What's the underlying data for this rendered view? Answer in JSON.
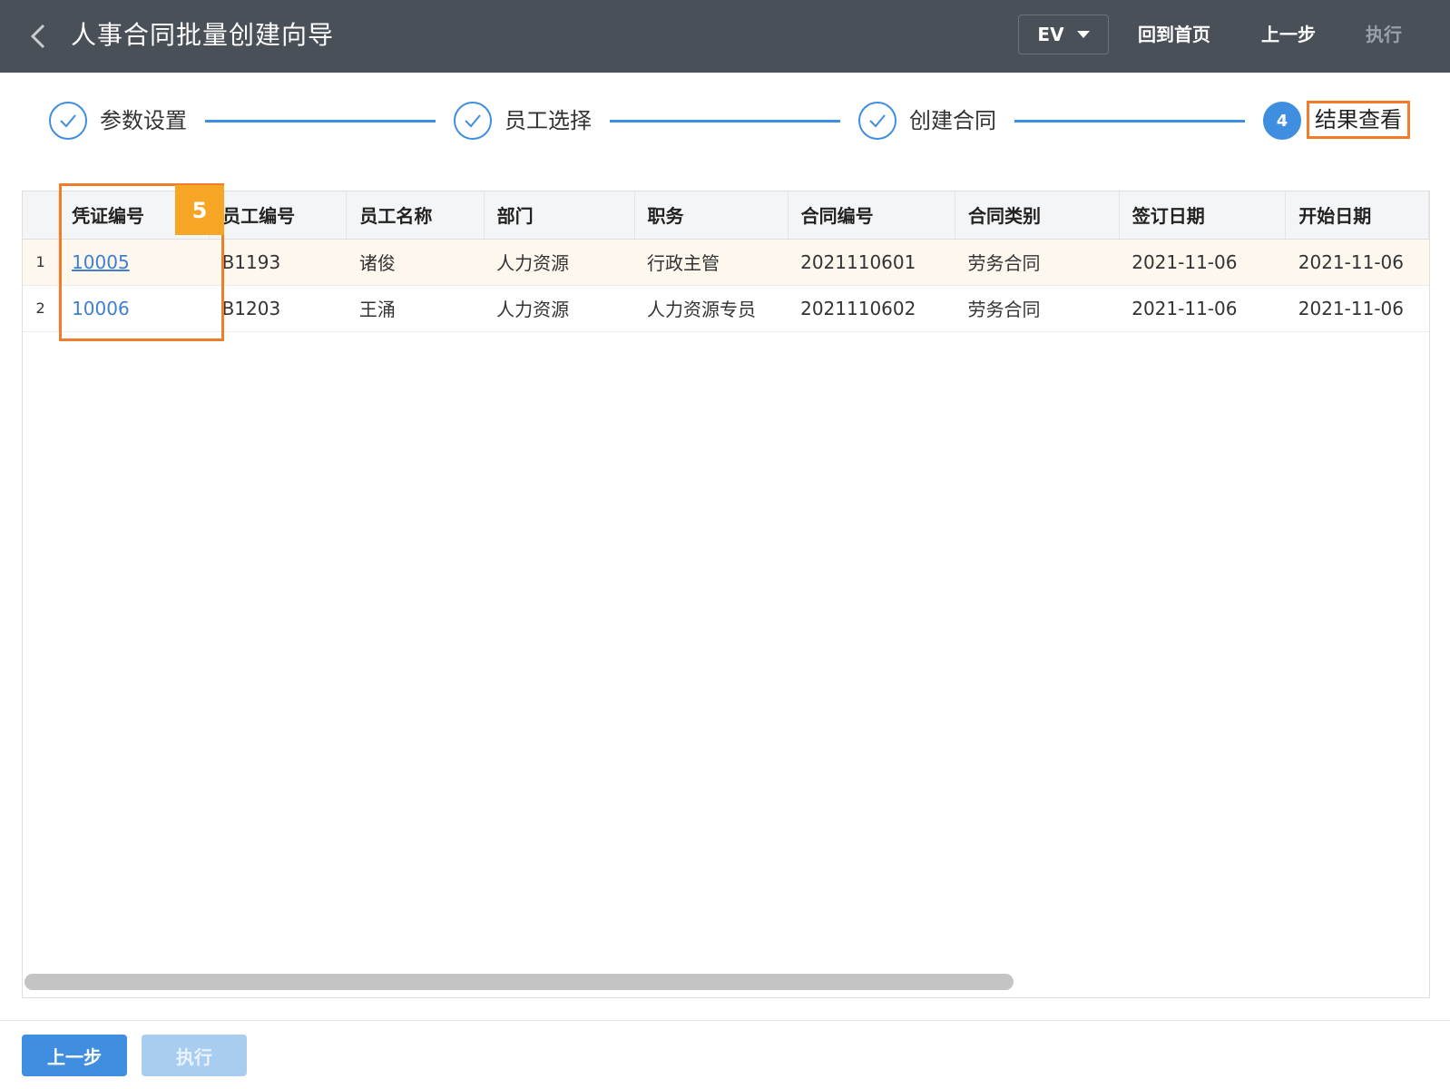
{
  "header": {
    "title": "人事合同批量创建向导",
    "language": "EV",
    "home_label": "回到首页",
    "prev_label": "上一步",
    "execute_label": "执行"
  },
  "steps": [
    {
      "label": "参数设置",
      "status": "done"
    },
    {
      "label": "员工选择",
      "status": "done"
    },
    {
      "label": "创建合同",
      "status": "done"
    },
    {
      "label": "结果查看",
      "status": "active",
      "number": "4"
    }
  ],
  "annotation": {
    "badge": "5"
  },
  "table": {
    "columns": [
      "凭证编号",
      "员工编号",
      "员工名称",
      "部门",
      "职务",
      "合同编号",
      "合同类别",
      "签订日期",
      "开始日期"
    ],
    "rows": [
      {
        "index": "1",
        "cells": [
          "10005",
          "B1193",
          "诸俊",
          "人力资源",
          "行政主管",
          "2021110601",
          "劳务合同",
          "2021-11-06",
          "2021-11-06"
        ]
      },
      {
        "index": "2",
        "cells": [
          "10006",
          "B1203",
          "王涌",
          "人力资源",
          "人力资源专员",
          "2021110602",
          "劳务合同",
          "2021-11-06",
          "2021-11-06"
        ]
      }
    ]
  },
  "footer": {
    "prev_label": "上一步",
    "execute_label": "执行"
  },
  "colors": {
    "header_bg": "#4a5058",
    "accent": "#3f8ee0",
    "annotation_border": "#ef7d2a",
    "badge_bg": "#f6a524"
  }
}
